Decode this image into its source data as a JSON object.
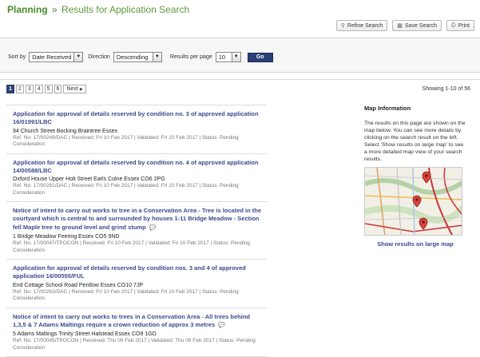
{
  "header": {
    "crumb": "Planning",
    "separator": "»",
    "title": "Results for Application Search"
  },
  "toolbar": {
    "refine_label": "Refine Search",
    "save_label": "Save Search",
    "print_label": "Print"
  },
  "filters": {
    "sort_label": "Sort by",
    "sort_value": "Date Received",
    "direction_label": "Direction",
    "direction_value": "Descending",
    "per_page_label": "Results per page",
    "per_page_value": "10",
    "go_label": "Go"
  },
  "pager": {
    "pages": [
      "1",
      "2",
      "3",
      "4",
      "5",
      "6"
    ],
    "next_label": "Next",
    "showing": "Showing 1-10 of 56"
  },
  "results": [
    {
      "title": "Application for approval of details reserved by condition no. 3 of approved application 16/01991/LBC",
      "address": "94 Church Street Bocking Braintree Essex",
      "meta": "Ref. No: 17/00248/DAC | Received: Fri 10 Feb 2017 | Validated: Fri 10 Feb 2017 | Status: Pending Consideration",
      "has_comment": false
    },
    {
      "title": "Application for approval of details reserved by condition no. 4 of approved application 14/00588/LBC",
      "address": "Oxford House Upper Holt Street Earls Colne Essex CO6 2PG",
      "meta": "Ref. No: 17/00261/DAC | Received: Fri 10 Feb 2017 | Validated: Fri 10 Feb 2017 | Status: Pending Consideration",
      "has_comment": false
    },
    {
      "title": "Notice of intent to carry out works to tree in a Conservation Area - Tree is located in the courtyard which is central to and surrounded by houses 1-11 Bridge Meadow - Section fell Maple tree to ground level and grind stump",
      "address": "1 Bridge Meadow Feering Essex CO5 9ND",
      "meta": "Ref. No: 17/00047/TPOCON | Received: Fri 10 Feb 2017 | Validated: Fri 10 Feb 2017 | Status: Pending Consideration",
      "has_comment": true
    },
    {
      "title": "Application for approval of details reserved by condition nos. 3 and 4 of approved application 16/00555/FUL",
      "address": "End Cottage School Road Pentlow Essex CO10 7JP",
      "meta": "Ref. No: 17/00263/DAC | Received: Fri 10 Feb 2017 | Validated: Fri 10 Feb 2017 | Status: Pending Consideration",
      "has_comment": false
    },
    {
      "title": "Notice of intent to carry out works to trees in a Conservation Area - All trees behind 1,3,5 & 7 Adams Maltings require a crown reduction of approx 3 metres",
      "address": "5 Adams Maltings Trinity Street Halstead Essex CO9 1GD",
      "meta": "Ref. No: 17/00045/TPOCON | Received: Thu 09 Feb 2017 | Validated: Thu 09 Feb 2017 | Status: Pending Consideration",
      "has_comment": true
    }
  ],
  "map": {
    "heading": "Map Information",
    "description": "The results on this page are shown on the map below. You can see more details by clicking on the search result on the left. Select 'Show results on large map' to see a more detailed map view of your search results.",
    "link_label": "Show results on large map",
    "marker_color": "#d9443f"
  },
  "colors": {
    "brand_green": "#5a9a3c",
    "link_blue": "#3b4a8c",
    "go_button": "#2d3f77"
  }
}
